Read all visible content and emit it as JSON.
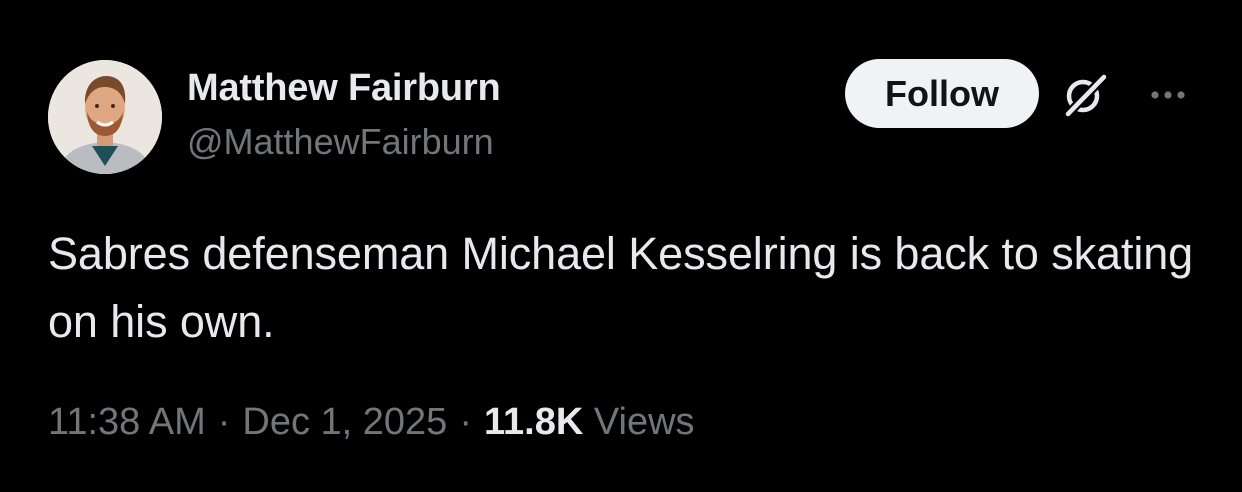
{
  "author": {
    "display_name": "Matthew Fairburn",
    "handle": "@MatthewFairburn",
    "avatar": "profile-photo"
  },
  "actions": {
    "follow_label": "Follow",
    "grok_icon": "grok-icon",
    "more_icon": "more-horizontal-icon"
  },
  "tweet": {
    "text": "Sabres defenseman Michael Kesselring is back to skating on his own."
  },
  "meta": {
    "time": "11:38 AM",
    "separator": "·",
    "date": "Dec 1, 2025",
    "views_count": "11.8K",
    "views_label": "Views"
  },
  "colors": {
    "background": "#000000",
    "primary_text": "#e7e9ea",
    "secondary_text": "#71767b",
    "follow_bg": "#eff3f4",
    "follow_text": "#0f1419"
  }
}
